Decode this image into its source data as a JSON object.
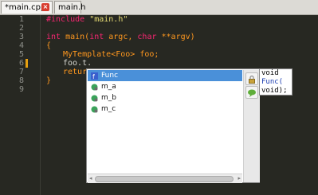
{
  "tabs": [
    {
      "label": "*main.cpp",
      "active": true
    },
    {
      "label": "main.h",
      "active": false
    }
  ],
  "close_glyph": "×",
  "line_numbers": [
    "1",
    "2",
    "3",
    "4",
    "5",
    "6",
    "7",
    "8",
    "9"
  ],
  "code": {
    "l1_pp": "#include",
    "l1_str": " \"main.h\"",
    "l3_kw1": "int",
    "l3_rest1": " main(",
    "l3_kw2": "int",
    "l3_rest2": " argc, ",
    "l3_kw3": "char",
    "l3_rest3": " **argv)",
    "l4": "{",
    "l5": "MyTemplate<Foo> foo;",
    "l6": "foo.t.",
    "l7": "return",
    "l8": "}"
  },
  "autocomplete": {
    "items": [
      {
        "label": "Func",
        "icon": "function-icon",
        "selected": true
      },
      {
        "label": "m_a",
        "icon": "member-variable-icon",
        "selected": false
      },
      {
        "label": "m_b",
        "icon": "member-variable-icon",
        "selected": false
      },
      {
        "label": "m_c",
        "icon": "member-variable-icon",
        "selected": false
      }
    ],
    "side_icons": [
      "lock-icon",
      "comment-icon"
    ]
  },
  "tooltip": {
    "line1": "void",
    "line2": "Func(",
    "line3": " void);"
  },
  "colors": {
    "editor_bg": "#272822",
    "selection": "#4a90d9",
    "keyword": "#f92672",
    "string": "#e6db74"
  }
}
